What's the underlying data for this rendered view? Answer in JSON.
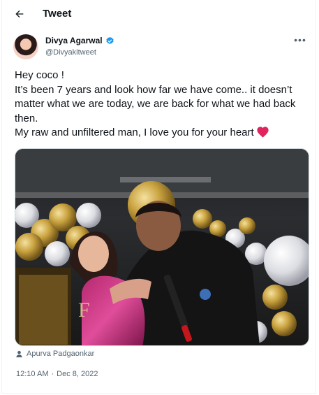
{
  "header": {
    "title": "Tweet",
    "back_icon": "arrow-left-icon"
  },
  "author": {
    "name": "Divya Agarwal",
    "handle": "@Divyakitweet",
    "verified_color": "#1d9bf0",
    "avatar": "profile-avatar"
  },
  "tweet": {
    "lines": [
      "Hey coco !",
      "It’s been 7 years and look how far we have come.. it doesn’t matter what we are today, we are back for what we had back then.",
      "My raw and unfiltered man, I love you for your heart"
    ],
    "emoji": "red-heart-icon",
    "photo": "photo-of-couple-at-party-with-gold-and-white-balloons"
  },
  "media_credit": {
    "icon": "person-icon",
    "name": "Apurva Padgaonkar"
  },
  "timestamp": {
    "time": "12:10 AM",
    "separator": "·",
    "date": "Dec 8, 2022"
  },
  "colors": {
    "text": "#0f1419",
    "muted": "#536471",
    "accent": "#1d9bf0",
    "heart": "#e0245e"
  }
}
